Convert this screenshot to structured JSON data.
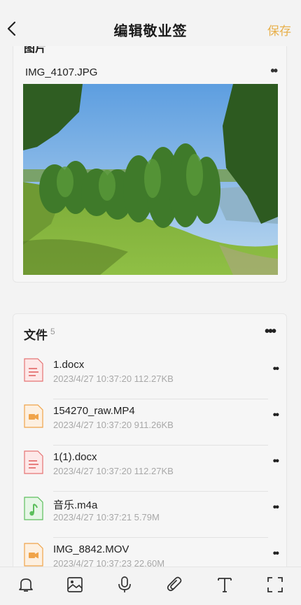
{
  "header": {
    "title": "编辑敬业签",
    "save_label": "保存"
  },
  "image_section": {
    "title": "图片",
    "file_name": "IMG_4107.JPG",
    "more_label": "••"
  },
  "file_section": {
    "title": "文件",
    "count": "5",
    "more_label": "•••",
    "files": [
      {
        "name": "1.docx",
        "meta": "2023/4/27 10:37:20  112.27KB",
        "type": "doc-icon",
        "color": "#e57373"
      },
      {
        "name": "154270_raw.MP4",
        "meta": "2023/4/27 10:37:20  911.26KB",
        "type": "video-icon",
        "color": "#f0a44a"
      },
      {
        "name": "1(1).docx",
        "meta": "2023/4/27 10:37:20  112.27KB",
        "type": "doc-icon",
        "color": "#e57373"
      },
      {
        "name": "音乐.m4a",
        "meta": "2023/4/27 10:37:21  5.79M",
        "type": "audio-icon",
        "color": "#5cbf5c"
      },
      {
        "name": "IMG_8842.MOV",
        "meta": "2023/4/27 10:37:23  22.60M",
        "type": "video-icon",
        "color": "#f0a44a"
      }
    ],
    "row_more_label": "••"
  },
  "toolbar": {
    "items": [
      "bell-icon",
      "image-icon",
      "microphone-icon",
      "paperclip-icon",
      "text-icon",
      "fullscreen-icon"
    ]
  },
  "colors": {
    "accent": "#e8b04b",
    "background": "#f3f3f3"
  }
}
